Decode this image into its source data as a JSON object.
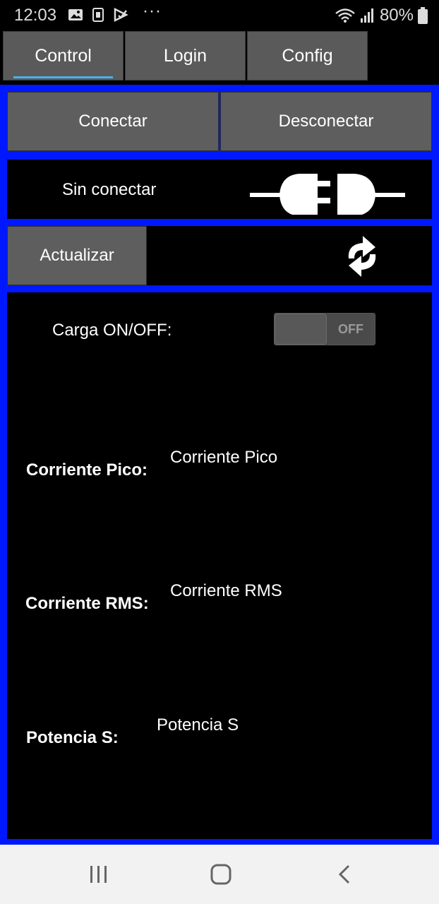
{
  "status_bar": {
    "time": "12:03",
    "more": "···",
    "battery": "80%"
  },
  "tabs": [
    {
      "label": "Control",
      "active": true
    },
    {
      "label": "Login",
      "active": false
    },
    {
      "label": "Config",
      "active": false
    }
  ],
  "connection": {
    "connect_label": "Conectar",
    "disconnect_label": "Desconectar",
    "status_text": "Sin conectar",
    "status_icon": "plug-disconnected-icon"
  },
  "refresh": {
    "button_label": "Actualizar",
    "icon": "refresh-icon"
  },
  "load": {
    "label": "Carga ON/OFF:",
    "switch_text": "OFF"
  },
  "measurements": {
    "peak_current_label": "Corriente Pico:",
    "peak_current_value": "Corriente Pico",
    "rms_current_label": "Corriente RMS:",
    "rms_current_value": "Corriente RMS",
    "apparent_power_label": "Potencia S:",
    "apparent_power_value": "Potencia S"
  },
  "colors": {
    "frame_blue": "#0018ff",
    "button_gray": "#5e5e5e",
    "tab_indicator": "#4ab0e8"
  }
}
